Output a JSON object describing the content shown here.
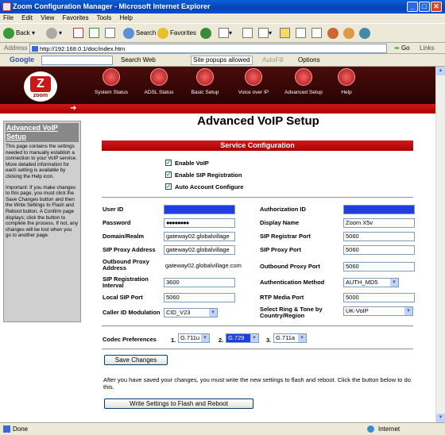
{
  "window": {
    "title": "Zoom Configuration Manager - Microsoft Internet Explorer",
    "min": "_",
    "max": "□",
    "close": "✕"
  },
  "menu": [
    "File",
    "Edit",
    "View",
    "Favorites",
    "Tools",
    "Help"
  ],
  "toolbar": {
    "back": "Back",
    "search": "Search",
    "favorites": "Favorites"
  },
  "address": {
    "label": "Address",
    "url": "http://192.168.0.1/doc/index.htm",
    "go": "Go",
    "links": "Links"
  },
  "google": {
    "label": "Google",
    "search_web": "Search Web",
    "popups": "Site popups allowed",
    "autofill": "AutoFill",
    "options": "Options"
  },
  "nav": [
    {
      "label": "System Status"
    },
    {
      "label": "ADSL Status"
    },
    {
      "label": "Basic Setup"
    },
    {
      "label": "Voice over IP"
    },
    {
      "label": "Advanced Setup"
    },
    {
      "label": "Help"
    }
  ],
  "logo": {
    "text": "zoom"
  },
  "sidebar": {
    "title": "Advanced VoIP Setup",
    "intro": "This page contains the settings needed to manually establish a connection to your VoIP service. More detailed information for each setting is available by clicking the Help icon.",
    "important": "Important: If you make changes to this page, you must click the Save Changes button and then the Write Settings to Flash and Reboot button. A Confirm page displays; click the button to complete the process. If not, any changes will be lost when you go to another page."
  },
  "page": {
    "title": "Advanced VoIP Setup",
    "section": "Service Configuration"
  },
  "checks": [
    {
      "label": "Enable VoIP",
      "checked": true
    },
    {
      "label": "Enable SIP Registration",
      "checked": true
    },
    {
      "label": "Auto Account Configure",
      "checked": true
    }
  ],
  "left_fields": [
    {
      "label": "User ID",
      "value": "",
      "highlight": true
    },
    {
      "label": "Password",
      "value": "●●●●●●●●",
      "highlight": false
    },
    {
      "label": "Domain/Realm",
      "value": "gateway02.globalvillage",
      "highlight": false
    },
    {
      "label": "SIP Proxy Address",
      "value": "gateway02.globalvillage",
      "highlight": false
    },
    {
      "label": "Outbound Proxy Address",
      "value": "gateway02.globalvillage.com",
      "highlight": false
    },
    {
      "label": "SIP Registration Interval",
      "value": "3600",
      "highlight": false
    },
    {
      "label": "Local SIP Port",
      "value": "5060",
      "highlight": false
    },
    {
      "label": "Caller ID Modulation",
      "value": "CID_V23",
      "highlight": false
    }
  ],
  "right_fields": [
    {
      "label": "Authorization ID",
      "value": "",
      "highlight": true
    },
    {
      "label": "Display Name",
      "value": "Zoom X5v",
      "highlight": false
    },
    {
      "label": "SIP Registrar Port",
      "value": "5060",
      "highlight": false
    },
    {
      "label": "SIP Proxy Port",
      "value": "5060",
      "highlight": false
    },
    {
      "label": "Outbound Proxy Port",
      "value": "5060",
      "highlight": false
    },
    {
      "label": "Authentication Method",
      "value": "AUTH_MD5",
      "highlight": false
    },
    {
      "label": "RTP Media Port",
      "value": "5000",
      "highlight": false
    },
    {
      "label": "Select Ring & Tone by Country/Region",
      "value": "UK-VoIP",
      "highlight": false
    }
  ],
  "codec": {
    "label": "Codec Preferences",
    "items": [
      {
        "num": "1.",
        "value": "G.711u"
      },
      {
        "num": "2.",
        "value": "G.729"
      },
      {
        "num": "3.",
        "value": "G.711a"
      }
    ]
  },
  "buttons": {
    "save": "Save Changes",
    "write": "Write Settings to Flash and Reboot"
  },
  "after_text": "After you have saved your changes, you must write the new settings to flash and reboot. Click the button below to do this.",
  "status": {
    "left": "Done",
    "zone": "Internet"
  }
}
